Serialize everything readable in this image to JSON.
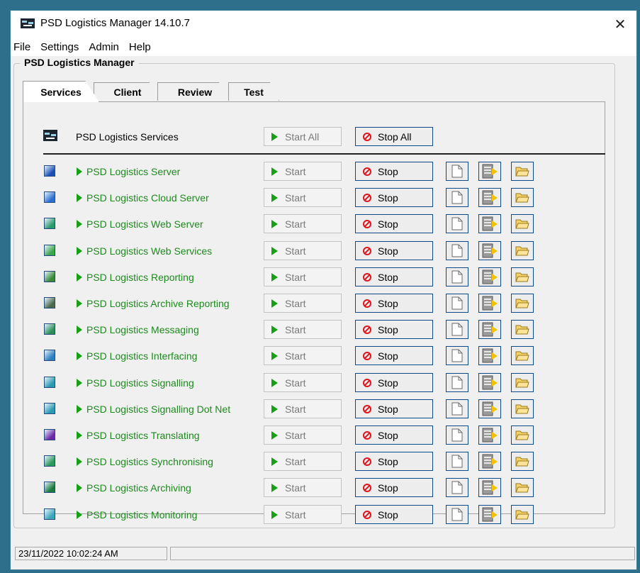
{
  "window": {
    "title": "PSD Logistics Manager 14.10.7",
    "close_label": "✕"
  },
  "menu": [
    "File",
    "Settings",
    "Admin",
    "Help"
  ],
  "group_title": "PSD Logistics Manager",
  "tabs": [
    "Services",
    "Client",
    "Review",
    "Test"
  ],
  "active_tab": "Services",
  "services_header": {
    "label": "PSD Logistics Services",
    "start_all": "Start All",
    "stop_all": "Stop All"
  },
  "buttons": {
    "start": "Start",
    "stop": "Stop"
  },
  "services": [
    {
      "name": "PSD Logistics Server",
      "icon": "globe-icon",
      "color": "#1b4fb3"
    },
    {
      "name": "PSD Logistics Cloud Server",
      "icon": "cloud-server-icon",
      "color": "#2c6fd1"
    },
    {
      "name": "PSD Logistics Web Server",
      "icon": "web-server-icon",
      "color": "#2a9a6e"
    },
    {
      "name": "PSD Logistics Web Services",
      "icon": "web-services-icon",
      "color": "#3aa64a"
    },
    {
      "name": "PSD Logistics Reporting",
      "icon": "report-icon",
      "color": "#3b8a3b"
    },
    {
      "name": "PSD Logistics Archive Reporting",
      "icon": "archive-report-icon",
      "color": "#4a6a4a"
    },
    {
      "name": "PSD Logistics Messaging",
      "icon": "envelope-icon",
      "color": "#2d8f5a"
    },
    {
      "name": "PSD Logistics Interfacing",
      "icon": "interface-icon",
      "color": "#2d7fbf"
    },
    {
      "name": "PSD Logistics Signalling",
      "icon": "signal-icon",
      "color": "#2a9ab2"
    },
    {
      "name": "PSD Logistics Signalling Dot Net",
      "icon": "signal-dotnet-icon",
      "color": "#2a9ab2"
    },
    {
      "name": "PSD Logistics Translating",
      "icon": "translate-icon",
      "color": "#6a2aa8"
    },
    {
      "name": "PSD Logistics Synchronising",
      "icon": "sync-icon",
      "color": "#2a9a5a"
    },
    {
      "name": "PSD Logistics Archiving",
      "icon": "archive-icon",
      "color": "#1b7a3b"
    },
    {
      "name": "PSD Logistics Monitoring",
      "icon": "monitor-icon",
      "color": "#3aa6b8"
    }
  ],
  "status": {
    "datetime": "23/11/2022 10:02:24 AM",
    "message": ""
  }
}
